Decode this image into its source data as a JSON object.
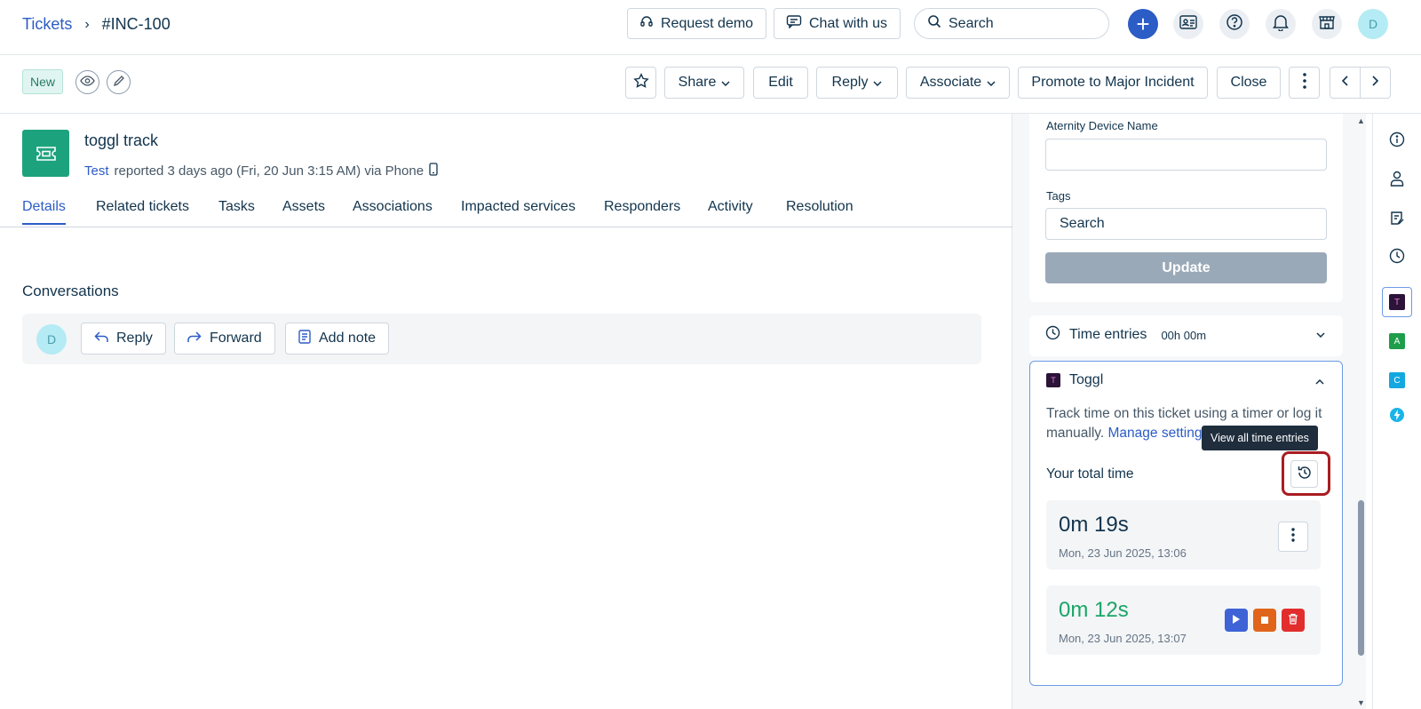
{
  "topbar": {
    "breadcrumb_root": "Tickets",
    "breadcrumb_sep": "›",
    "breadcrumb_current": "#INC-100",
    "request_demo": "Request demo",
    "chat": "Chat with us",
    "search_placeholder": "Search",
    "avatar_initial": "D"
  },
  "actionbar": {
    "status": "New",
    "share": "Share",
    "edit": "Edit",
    "reply": "Reply",
    "associate": "Associate",
    "promote": "Promote to Major Incident",
    "close": "Close"
  },
  "ticket": {
    "title": "toggl track",
    "requester": "Test",
    "meta": "reported 3 days ago (Fri, 20 Jun 3:15 AM) via Phone"
  },
  "tabs": [
    "Details",
    "Related tickets",
    "Tasks",
    "Assets",
    "Associations",
    "Impacted services",
    "Responders",
    "Activity",
    "Resolution"
  ],
  "conversations": {
    "title": "Conversations",
    "avatar_initial": "D",
    "reply": "Reply",
    "forward": "Forward",
    "add_note": "Add note"
  },
  "properties": {
    "device_label": "Aternity Device Name",
    "device_value": "",
    "tags_label": "Tags",
    "tags_placeholder": "Search",
    "update": "Update"
  },
  "time_entries": {
    "label": "Time entries",
    "value": "00h 00m"
  },
  "toggl": {
    "logo_letter": "T",
    "title": "Toggl",
    "description": "Track time on this ticket using a timer or log it manually.",
    "manage_link": "Manage settings",
    "tooltip": "View all time entries",
    "total_label": "Your total time",
    "entries": [
      {
        "duration": "0m 19s",
        "when": "Mon, 23 Jun 2025, 13:06"
      },
      {
        "duration": "0m 12s",
        "when": "Mon, 23 Jun 2025, 13:07"
      }
    ]
  },
  "rail_apps": [
    {
      "letter": "T",
      "color": "#2c1338"
    },
    {
      "letter": "A",
      "color": "#1e9e4a"
    },
    {
      "letter": "C",
      "color": "#14a8e0"
    }
  ],
  "colors": {
    "brand": "#2c5cc5",
    "ticket_icon": "#1ca37d",
    "play": "#3d63d6",
    "stop": "#e0651a",
    "delete": "#e22d2d",
    "highlight": "#a91d22"
  }
}
